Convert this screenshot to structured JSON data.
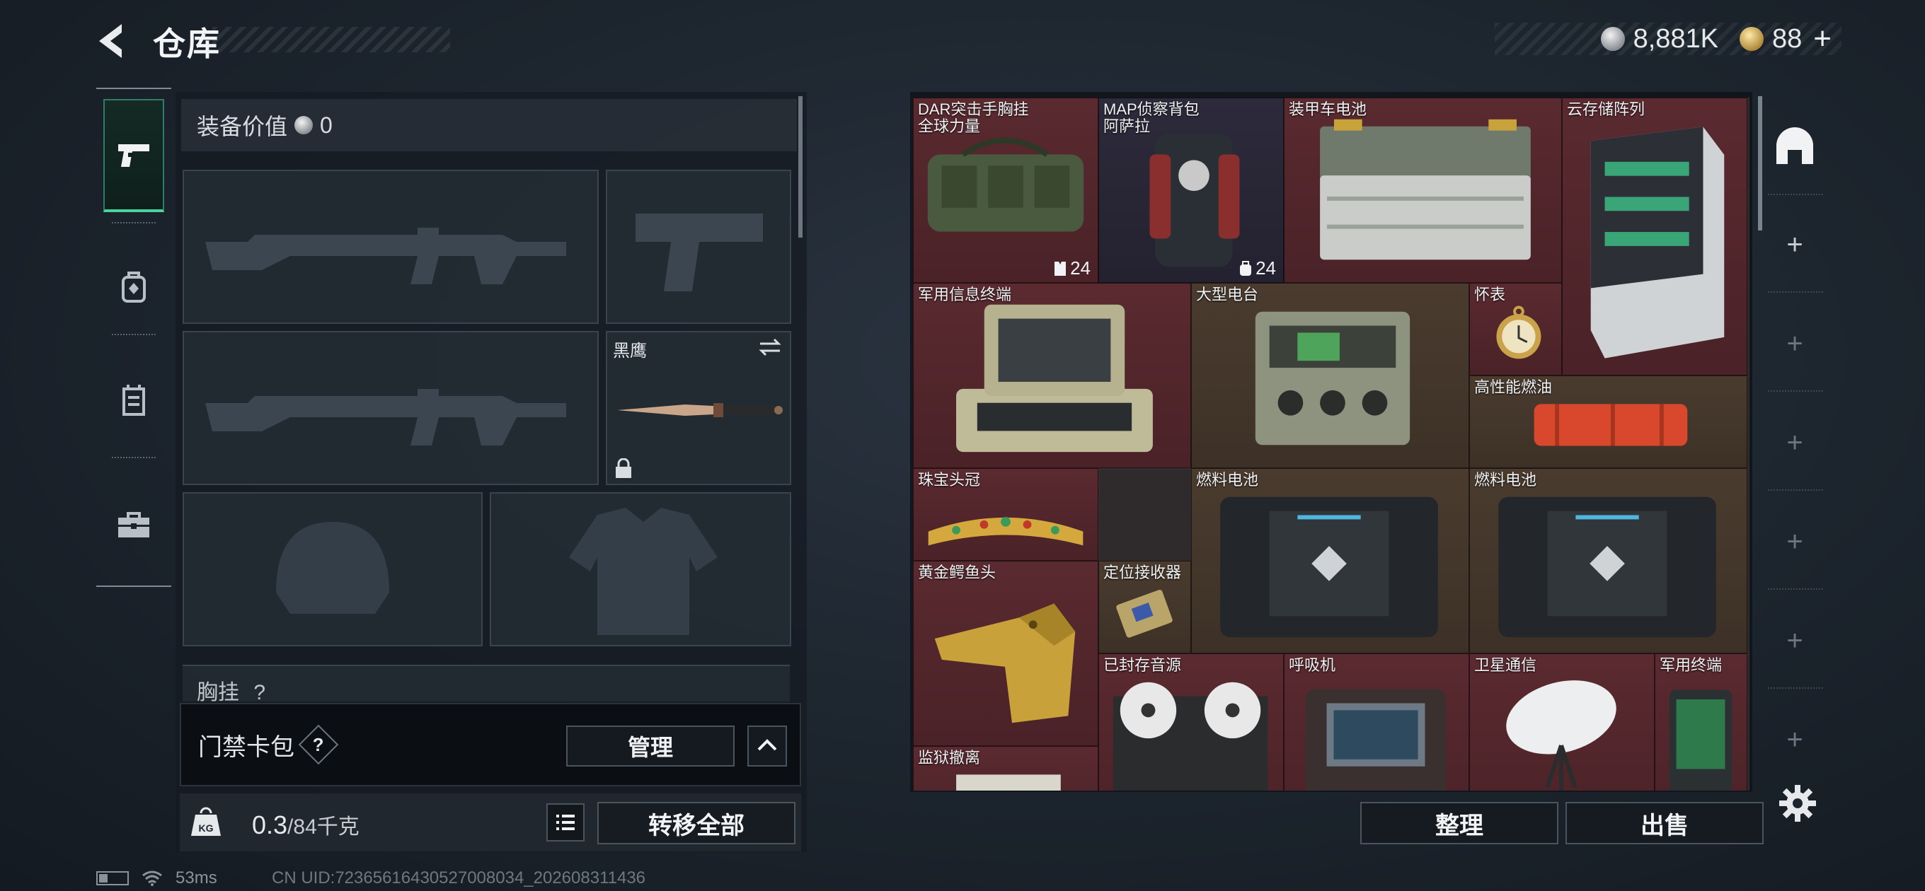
{
  "header": {
    "title": "仓库",
    "currencies": [
      {
        "name": "silver-coin-icon",
        "value": "8,881K"
      },
      {
        "name": "gold-coin-icon",
        "value": "88"
      }
    ],
    "add_label": "+"
  },
  "tabs": [
    {
      "icon": "pistol-icon",
      "active": true
    },
    {
      "icon": "backpack-icon",
      "active": false
    },
    {
      "icon": "vest-icon",
      "active": false
    },
    {
      "icon": "briefcase-icon",
      "active": false
    }
  ],
  "loadout": {
    "equip_value_label": "装备价值",
    "equip_value": "0",
    "melee_slot_label": "黑鹰",
    "chest_label": "胸挂",
    "chest_help": "?",
    "keycard": {
      "label": "门禁卡包",
      "help": "?",
      "manage_label": "管理"
    },
    "weight": {
      "current": "0.3",
      "max": "/84千克",
      "icon_text": "KG"
    },
    "transfer_all_label": "转移全部"
  },
  "warehouse": {
    "items": [
      {
        "name_line1": "DAR突击手胸挂",
        "name_line2": "全球力量",
        "count": "24",
        "count_icon": "vest-icon",
        "rarity": "red"
      },
      {
        "name_line1": "MAP侦察背包",
        "name_line2": "阿萨拉",
        "count": "24",
        "count_icon": "backpack-icon",
        "rarity": "purple"
      },
      {
        "name_line1": "装甲车电池",
        "rarity": "red"
      },
      {
        "name_line1": "云存储阵列",
        "rarity": "red"
      },
      {
        "name_line1": "军用信息终端",
        "rarity": "red"
      },
      {
        "name_line1": "大型电台",
        "rarity": "gold"
      },
      {
        "name_line1": "怀表",
        "rarity": "red"
      },
      {
        "name_line1": "高性能燃油",
        "rarity": "gold"
      },
      {
        "name_line1": "珠宝头冠",
        "rarity": "red"
      },
      {
        "name_line1": "燃料电池",
        "rarity": "gold"
      },
      {
        "name_line1": "燃料电池",
        "rarity": "gold"
      },
      {
        "name_line1": "黄金鳄鱼头",
        "rarity": "red"
      },
      {
        "name_line1": "定位接收器",
        "rarity": "gold"
      },
      {
        "name_line1": "已封存音源",
        "rarity": "red"
      },
      {
        "name_line1": "呼吸机",
        "rarity": "red"
      },
      {
        "name_line1": "卫星通信",
        "rarity": "red"
      },
      {
        "name_line1": "军用终端",
        "rarity": "red"
      },
      {
        "name_line1": "监狱撤离",
        "rarity": "red"
      }
    ],
    "sort_label": "整理",
    "sell_label": "出售",
    "rail_plus": "+"
  },
  "status": {
    "ping": "53ms",
    "uid": "CN UID:72365616430527008034_202608311436"
  },
  "colors": {
    "accent_green": "#48d39f",
    "rarity_red": "#5a2a30",
    "rarity_gold": "#4a3b2e",
    "rarity_purple": "#2d2a3b"
  }
}
